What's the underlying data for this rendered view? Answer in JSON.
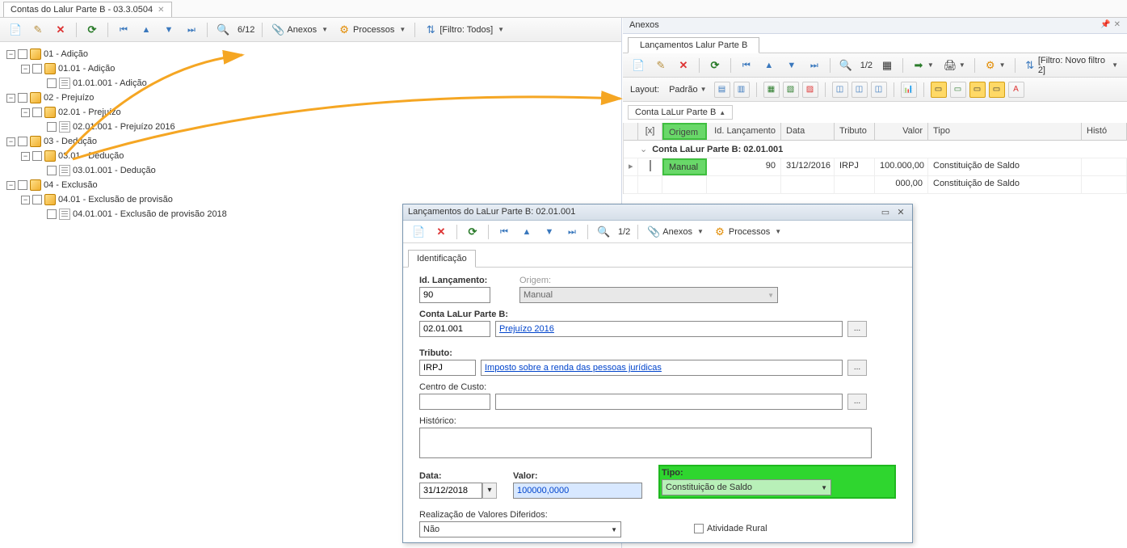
{
  "tab": {
    "title": "Contas do Lalur Parte B - 03.3.0504"
  },
  "left_toolbar": {
    "counter": "6/12",
    "anexos": "Anexos",
    "processos": "Processos",
    "filtro": "[Filtro: Todos]"
  },
  "tree": [
    {
      "code": "01",
      "label": "01 - Adição",
      "children": [
        {
          "code": "01.01",
          "label": "01.01 - Adição",
          "children": [
            {
              "code": "01.01.001",
              "label": "01.01.001 - Adição"
            }
          ]
        }
      ]
    },
    {
      "code": "02",
      "label": "02 - Prejuízo",
      "children": [
        {
          "code": "02.01",
          "label": "02.01 - Prejuízo",
          "children": [
            {
              "code": "02.01.001",
              "label": "02.01.001 - Prejuízo 2016"
            }
          ]
        }
      ]
    },
    {
      "code": "03",
      "label": "03 - Dedução",
      "children": [
        {
          "code": "03.01",
          "label": "03.01 - Dedução",
          "children": [
            {
              "code": "03.01.001",
              "label": "03.01.001 - Dedução"
            }
          ]
        }
      ]
    },
    {
      "code": "04",
      "label": "04 - Exclusão",
      "children": [
        {
          "code": "04.01",
          "label": "04.01 - Exclusão de provisão",
          "children": [
            {
              "code": "04.01.001",
              "label": "04.01.001 - Exclusão de provisão 2018"
            }
          ]
        }
      ]
    }
  ],
  "right_panel": {
    "title": "Anexos",
    "subtab": "Lançamentos Lalur Parte B",
    "toolbar": {
      "counter": "1/2",
      "filtro": "[Filtro: Novo filtro 2]"
    },
    "layout_label": "Layout:",
    "layout_value": "Padrão",
    "group_label": "Conta LaLur Parte B",
    "columns": {
      "x": "[x]",
      "origem": "Origem",
      "idlanc": "Id. Lançamento",
      "data": "Data",
      "tributo": "Tributo",
      "valor": "Valor",
      "tipo": "Tipo",
      "hist": "Histó"
    },
    "group_row": "Conta LaLur Parte B: 02.01.001",
    "rows": [
      {
        "origem": "Manual",
        "idlanc": "90",
        "data": "31/12/2016",
        "tributo": "IRPJ",
        "valor": "100.000,00",
        "tipo": "Constituição de Saldo"
      },
      {
        "origem": "",
        "idlanc": "",
        "data": "",
        "tributo": "",
        "valor": "000,00",
        "tipo": "Constituição de Saldo"
      }
    ]
  },
  "dialog": {
    "title": "Lançamentos do LaLur Parte B: 02.01.001",
    "toolbar": {
      "counter": "1/2",
      "anexos": "Anexos",
      "processos": "Processos"
    },
    "tab": "Identificação",
    "fields": {
      "id_lanc_label": "Id. Lançamento:",
      "id_lanc_value": "90",
      "origem_label": "Origem:",
      "origem_value": "Manual",
      "conta_label": "Conta LaLur Parte B:",
      "conta_code": "02.01.001",
      "conta_desc": "Prejuízo 2016",
      "tributo_label": "Tributo:",
      "tributo_code": "IRPJ",
      "tributo_desc": "Imposto sobre a renda das pessoas jurídicas",
      "centro_label": "Centro de Custo:",
      "historico_label": "Histórico:",
      "data_label": "Data:",
      "data_value": "31/12/2018",
      "valor_label": "Valor:",
      "valor_value": "100000,0000",
      "tipo_label": "Tipo:",
      "tipo_value": "Constituição de Saldo",
      "realiz_label": "Realização de Valores Diferidos:",
      "realiz_value": "Não",
      "atividade_label": "Atividade Rural",
      "browse": "..."
    }
  }
}
